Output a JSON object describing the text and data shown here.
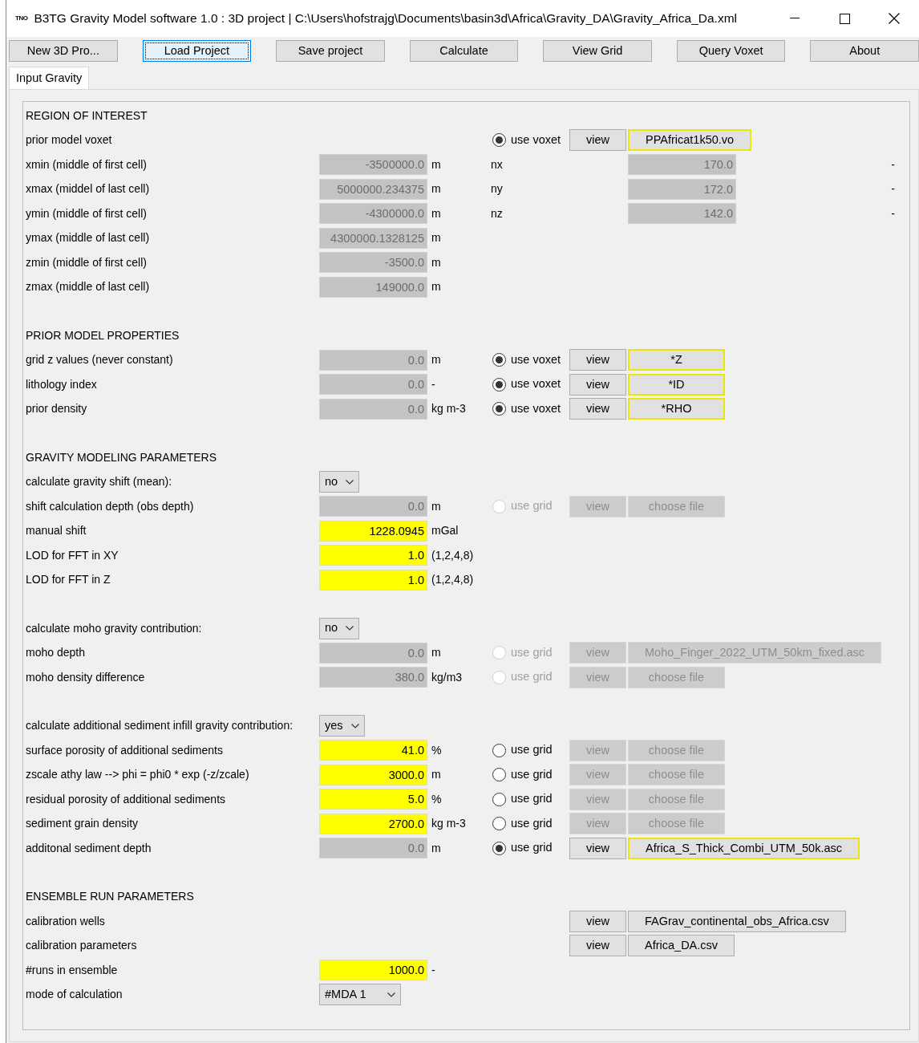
{
  "window": {
    "logo": "TNO",
    "title": "B3TG Gravity Model software 1.0 : 3D project | C:\\Users\\hofstrajg\\Documents\\basin3d\\Africa\\Gravity_DA\\Gravity_Africa_Da.xml"
  },
  "toolbar": [
    {
      "label": "New 3D Pro...",
      "focused": false
    },
    {
      "label": "Load Project",
      "focused": true
    },
    {
      "label": "Save project",
      "focused": false
    },
    {
      "label": "Calculate",
      "focused": false
    },
    {
      "label": "View Grid",
      "focused": false
    },
    {
      "label": "Query Voxet",
      "focused": false
    },
    {
      "label": "About",
      "focused": false
    }
  ],
  "tabs": [
    {
      "label": "Input Gravity",
      "selected": true
    }
  ],
  "sections": [
    {
      "title": "REGION OF INTEREST",
      "rows": [
        {
          "label": "prior model voxet",
          "option": {
            "label": "use voxet",
            "selected": true,
            "disabled": false
          },
          "view": {
            "label": "view",
            "disabled": false
          },
          "file": {
            "label": "PPAfricat1k50.vo",
            "disabled": false,
            "highlighted": true
          }
        },
        {
          "label": "xmin (middle of first cell)",
          "field": {
            "value": "-3500000.0",
            "kind": "readonly"
          },
          "unit": "m",
          "dim": {
            "label": "nx",
            "value": "170.0",
            "unit": "-"
          }
        },
        {
          "label": "xmax (middel of last cell)",
          "field": {
            "value": "5000000.234375",
            "kind": "readonly"
          },
          "unit": "m",
          "dim": {
            "label": "ny",
            "value": "172.0",
            "unit": "-"
          }
        },
        {
          "label": "ymin (middle of first cell)",
          "field": {
            "value": "-4300000.0",
            "kind": "readonly"
          },
          "unit": "m",
          "dim": {
            "label": "nz",
            "value": "142.0",
            "unit": "-"
          }
        },
        {
          "label": "ymax (middle of last cell)",
          "field": {
            "value": "4300000.1328125",
            "kind": "readonly"
          },
          "unit": "m"
        },
        {
          "label": "zmin (middle of first cell)",
          "field": {
            "value": "-3500.0",
            "kind": "readonly"
          },
          "unit": "m"
        },
        {
          "label": "zmax (middle of last cell)",
          "field": {
            "value": "149000.0",
            "kind": "readonly"
          },
          "unit": "m"
        }
      ]
    },
    {
      "title": "PRIOR MODEL PROPERTIES",
      "rows": [
        {
          "label": "grid z values (never constant)",
          "field": {
            "value": "0.0",
            "kind": "readonly"
          },
          "unit": "m",
          "option": {
            "label": "use voxet",
            "selected": true,
            "disabled": false
          },
          "view": {
            "label": "view",
            "disabled": false
          },
          "file": {
            "label": "*Z",
            "disabled": false,
            "highlighted": true
          }
        },
        {
          "label": "lithology index",
          "field": {
            "value": "0.0",
            "kind": "readonly"
          },
          "unit": "-",
          "option": {
            "label": "use voxet",
            "selected": true,
            "disabled": false
          },
          "view": {
            "label": "view",
            "disabled": false
          },
          "file": {
            "label": "*ID",
            "disabled": false,
            "highlighted": true
          }
        },
        {
          "label": "prior density",
          "field": {
            "value": "0.0",
            "kind": "readonly"
          },
          "unit": "kg m-3",
          "option": {
            "label": "use voxet",
            "selected": true,
            "disabled": false
          },
          "view": {
            "label": "view",
            "disabled": false
          },
          "file": {
            "label": "*RHO",
            "disabled": false,
            "highlighted": true
          }
        }
      ]
    },
    {
      "title": "GRAVITY MODELING PARAMETERS",
      "rows": [
        {
          "label": "calculate gravity shift (mean):",
          "select": {
            "value": "no"
          }
        },
        {
          "label": "shift calculation depth (obs depth)",
          "field": {
            "value": "0.0",
            "kind": "readonly"
          },
          "unit": "m",
          "option": {
            "label": "use grid",
            "selected": false,
            "disabled": true
          },
          "view": {
            "label": "view",
            "disabled": true
          },
          "file": {
            "label": "choose file",
            "disabled": true,
            "highlighted": false
          }
        },
        {
          "label": "manual shift",
          "field": {
            "value": "1228.0945",
            "kind": "editable"
          },
          "unit": "mGal"
        },
        {
          "label": "LOD for FFT in XY",
          "field": {
            "value": "1.0",
            "kind": "editable"
          },
          "unit": "(1,2,4,8)"
        },
        {
          "label": "LOD for FFT in Z",
          "field": {
            "value": "1.0",
            "kind": "editable"
          },
          "unit": "(1,2,4,8)"
        }
      ]
    },
    {
      "rows": [
        {
          "label": "calculate moho gravity contribution:",
          "select": {
            "value": "no"
          }
        },
        {
          "label": "moho depth",
          "field": {
            "value": "0.0",
            "kind": "readonly"
          },
          "unit": "m",
          "option": {
            "label": "use grid",
            "selected": false,
            "disabled": true
          },
          "view": {
            "label": "view",
            "disabled": true
          },
          "file": {
            "label": "Moho_Finger_2022_UTM_50km_fixed.asc",
            "disabled": true,
            "highlighted": false
          }
        },
        {
          "label": "moho density difference",
          "field": {
            "value": "380.0",
            "kind": "readonly"
          },
          "unit": "kg/m3",
          "option": {
            "label": "use grid",
            "selected": false,
            "disabled": true
          },
          "view": {
            "label": "view",
            "disabled": true
          },
          "file": {
            "label": "choose file",
            "disabled": true,
            "highlighted": false
          }
        }
      ]
    },
    {
      "rows": [
        {
          "label": "calculate additional sediment infill gravity contribution:",
          "select": {
            "value": "yes"
          }
        },
        {
          "label": "surface porosity of additional sediments",
          "field": {
            "value": "41.0",
            "kind": "editable"
          },
          "unit": "%",
          "option": {
            "label": "use grid",
            "selected": false,
            "disabled": false
          },
          "view": {
            "label": "view",
            "disabled": true
          },
          "file": {
            "label": "choose file",
            "disabled": true,
            "highlighted": false
          }
        },
        {
          "label": "zscale athy law --> phi = phi0 * exp (-z/zcale)",
          "field": {
            "value": "3000.0",
            "kind": "editable"
          },
          "unit": "m",
          "option": {
            "label": "use grid",
            "selected": false,
            "disabled": false
          },
          "view": {
            "label": "view",
            "disabled": true
          },
          "file": {
            "label": "choose file",
            "disabled": true,
            "highlighted": false
          }
        },
        {
          "label": "residual porosity of additional sediments",
          "field": {
            "value": "5.0",
            "kind": "editable"
          },
          "unit": "%",
          "option": {
            "label": "use grid",
            "selected": false,
            "disabled": false
          },
          "view": {
            "label": "view",
            "disabled": true
          },
          "file": {
            "label": "choose file",
            "disabled": true,
            "highlighted": false
          }
        },
        {
          "label": "sediment grain density",
          "field": {
            "value": "2700.0",
            "kind": "editable"
          },
          "unit": "kg m-3",
          "option": {
            "label": "use grid",
            "selected": false,
            "disabled": false
          },
          "view": {
            "label": "view",
            "disabled": true
          },
          "file": {
            "label": "choose file",
            "disabled": true,
            "highlighted": false
          }
        },
        {
          "label": "additonal sediment depth",
          "field": {
            "value": "0.0",
            "kind": "readonly"
          },
          "unit": "m",
          "option": {
            "label": "use grid",
            "selected": true,
            "disabled": false
          },
          "view": {
            "label": "view",
            "disabled": false
          },
          "file": {
            "label": "Africa_S_Thick_Combi_UTM_50k.asc",
            "disabled": false,
            "highlighted": true
          }
        }
      ]
    },
    {
      "title": "ENSEMBLE RUN PARAMETERS",
      "rows": [
        {
          "label": "calibration wells",
          "view": {
            "label": "view",
            "disabled": false
          },
          "file": {
            "label": "FAGrav_continental_obs_Africa.csv",
            "disabled": false,
            "highlighted": false
          }
        },
        {
          "label": "calibration parameters",
          "view": {
            "label": "view",
            "disabled": false
          },
          "file": {
            "label": "Africa_DA.csv",
            "disabled": false,
            "highlighted": false
          }
        },
        {
          "label": "#runs in ensemble",
          "field": {
            "value": "1000.0",
            "kind": "editable"
          },
          "unit": "-"
        },
        {
          "label": "mode of calculation",
          "select": {
            "value": "#MDA 1"
          }
        }
      ]
    }
  ]
}
